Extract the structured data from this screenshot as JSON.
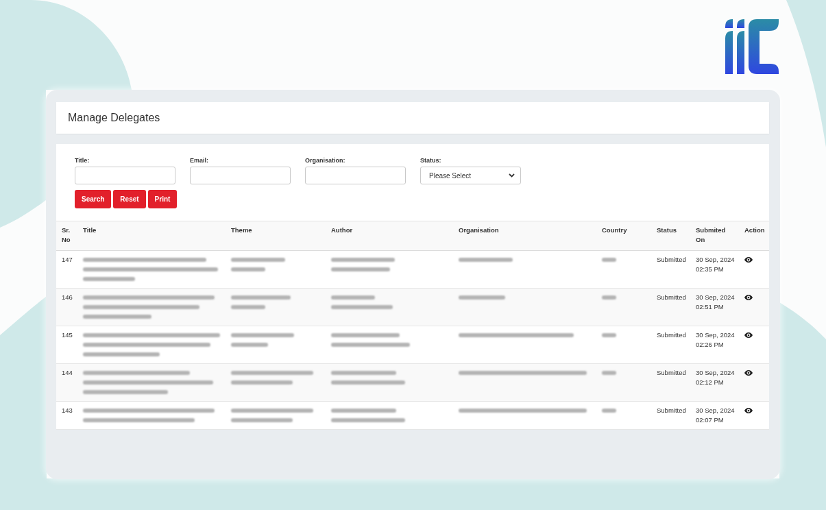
{
  "page_title": "Manage Delegates",
  "filters": [
    {
      "kind": "text",
      "label": "Title:"
    },
    {
      "kind": "text",
      "label": "Email:"
    },
    {
      "kind": "text",
      "label": "Organisation:"
    },
    {
      "kind": "select",
      "label": "Status:",
      "value": "Please Select"
    }
  ],
  "buttons": [
    "Search",
    "Reset",
    "Print"
  ],
  "table": {
    "columns": [
      "Sr. No",
      "Title",
      "Theme",
      "Author",
      "Organisation",
      "Country",
      "Status",
      "Submited On",
      "Action"
    ],
    "rows": [
      {
        "sr_no": "147",
        "status": "Submitted",
        "submitted_on": "30 Sep, 2024 02:35 PM"
      },
      {
        "sr_no": "146",
        "status": "Submitted",
        "submitted_on": "30 Sep, 2024 02:51 PM"
      },
      {
        "sr_no": "145",
        "status": "Submitted",
        "submitted_on": "30 Sep, 2024 02:26 PM"
      },
      {
        "sr_no": "144",
        "status": "Submitted",
        "submitted_on": "30 Sep, 2024 02:12 PM"
      },
      {
        "sr_no": "143",
        "status": "Submitted",
        "submitted_on": "30 Sep, 2024 02:07 PM"
      }
    ]
  }
}
